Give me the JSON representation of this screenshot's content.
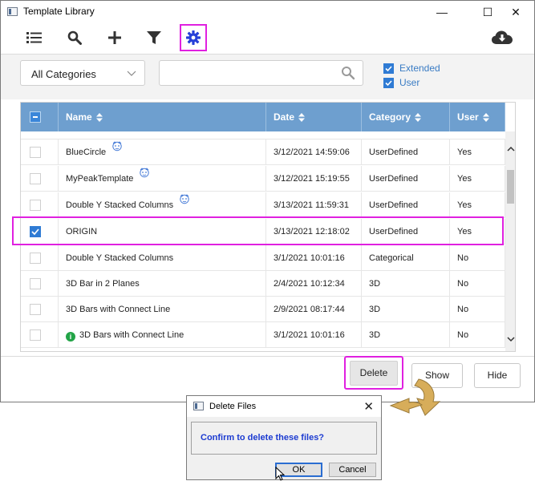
{
  "window": {
    "title": "Template Library",
    "controls": {
      "minimize": "—",
      "maximize": "☐",
      "close": "✕"
    }
  },
  "toolbar": {
    "icons": [
      "list-icon",
      "search-icon",
      "plus-icon",
      "filter-icon",
      "gear-icon",
      "cloud-download-icon"
    ],
    "selected": "gear-icon",
    "accent_color": "#2740d8",
    "highlight_color": "#e020e0"
  },
  "filters": {
    "category_select": "All Categories",
    "search_value": "",
    "extended_label": "Extended",
    "user_label": "User",
    "extended_checked": true,
    "user_checked": true
  },
  "table": {
    "columns": [
      "Name",
      "Date",
      "Category",
      "User"
    ],
    "header_color": "#6e9fcf",
    "rows": [
      {
        "name": "BlueCircle",
        "date": "3/12/2021 14:59:06",
        "category": "UserDefined",
        "user": "Yes",
        "checked": false,
        "badge": "user-icon"
      },
      {
        "name": "MyPeakTemplate",
        "date": "3/12/2021 15:19:55",
        "category": "UserDefined",
        "user": "Yes",
        "checked": false,
        "badge": "user-icon"
      },
      {
        "name": "Double Y Stacked Columns",
        "date": "3/13/2021 11:59:31",
        "category": "UserDefined",
        "user": "Yes",
        "checked": false,
        "badge": "user-icon"
      },
      {
        "name": "ORIGIN",
        "date": "3/13/2021 12:18:02",
        "category": "UserDefined",
        "user": "Yes",
        "checked": true,
        "badge": ""
      },
      {
        "name": "Double Y Stacked Columns",
        "date": "3/1/2021 10:01:16",
        "category": "Categorical",
        "user": "No",
        "checked": false,
        "badge": ""
      },
      {
        "name": "3D Bar in 2 Planes",
        "date": "2/4/2021 10:12:34",
        "category": "3D",
        "user": "No",
        "checked": false,
        "badge": ""
      },
      {
        "name": "3D Bars with Connect Line",
        "date": "2/9/2021 08:17:44",
        "category": "3D",
        "user": "No",
        "checked": false,
        "badge": ""
      },
      {
        "name": "3D Bars with Connect Line",
        "date": "3/1/2021 10:01:16",
        "category": "3D",
        "user": "No",
        "checked": false,
        "badge": "info-icon"
      }
    ]
  },
  "buttons": {
    "delete": "Delete",
    "show": "Show",
    "hide": "Hide"
  },
  "dialog": {
    "title": "Delete Files",
    "message": "Confirm to delete these files?",
    "ok": "OK",
    "cancel": "Cancel",
    "close": "✕"
  }
}
